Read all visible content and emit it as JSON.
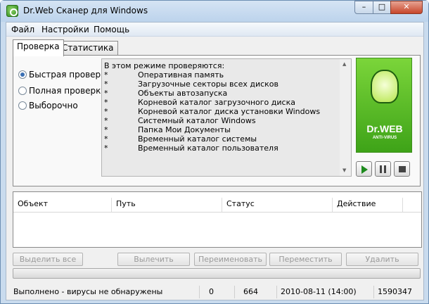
{
  "window": {
    "title": "Dr.Web Сканер для Windows",
    "controls": {
      "minimize": "–",
      "maximize": "□",
      "close": "✕"
    }
  },
  "menu": [
    "Файл",
    "Настройки",
    "Помощь"
  ],
  "tabs": [
    {
      "label": "Проверка",
      "active": true
    },
    {
      "label": "Статистика",
      "active": false
    }
  ],
  "scan_modes": [
    {
      "label": "Быстрая проверка",
      "checked": true
    },
    {
      "label": "Полная проверка",
      "checked": false
    },
    {
      "label": "Выборочно",
      "checked": false
    }
  ],
  "info": {
    "heading": "В этом режиме проверяются:",
    "bullet": "*",
    "items": [
      "Оперативная память",
      "Загрузочные секторы всех дисков",
      "Объекты автозапуска",
      "Корневой каталог загрузочного диска",
      "Корневой каталог диска установки Windows",
      "Системный каталог Windows",
      "Папка Мои Документы",
      "Временный каталог системы",
      "Временный каталог пользователя"
    ]
  },
  "logo": {
    "brand": "Dr.WEB",
    "subtitle": "ANTI-VIRUS"
  },
  "controls": [
    "play-icon",
    "pause-icon",
    "stop-icon"
  ],
  "results_table": {
    "columns": [
      "Объект",
      "Путь",
      "Статус",
      "Действие"
    ]
  },
  "actions": [
    "Выделить все",
    "Вылечить",
    "Переименовать",
    "Переместить",
    "Удалить"
  ],
  "progress_percent": 0,
  "status": {
    "message": "Выполнено - вирусы не обнаружены",
    "count1": "0",
    "count2": "664",
    "datetime": "2010-08-11 (14:00)",
    "count3": "1590347"
  },
  "colors": {
    "accent_green": "#3ea318",
    "titlebar": "#c9dbee"
  }
}
